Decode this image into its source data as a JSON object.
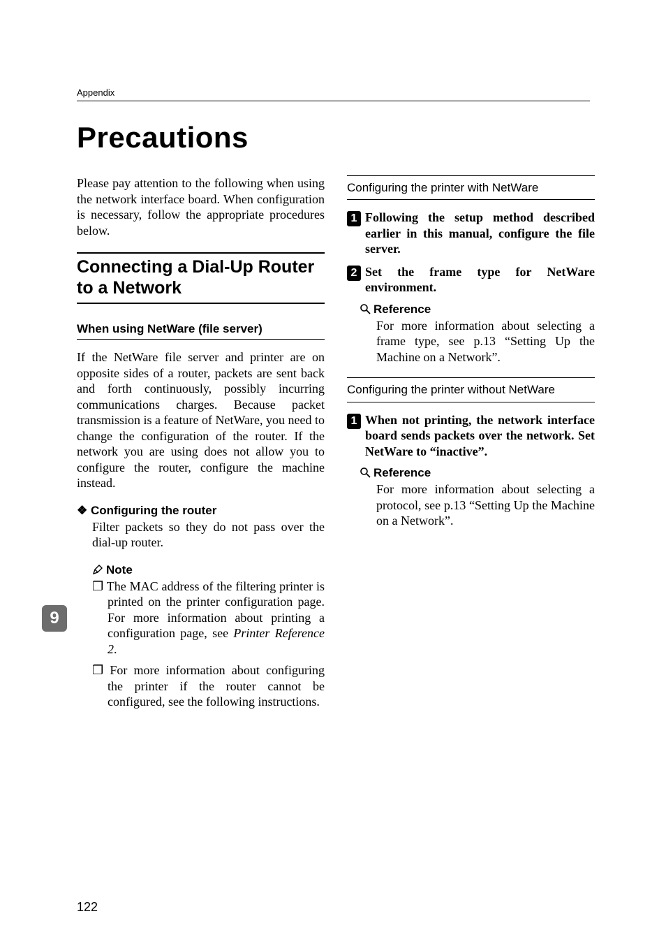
{
  "running_head": "Appendix",
  "title": "Precautions",
  "tab_number": "9",
  "page_number": "122",
  "left": {
    "intro": "Please pay attention to the following when using the network interface board. When configuration is necessary, follow the appropriate procedures below.",
    "h2": "Connecting a Dial-Up Router to a Network",
    "h3": "When using NetWare (file server)",
    "body1": "If the NetWare file server and printer are on opposite sides of a router, packets are sent back and forth continuously, possibly incurring communications charges. Because packet transmission is a feature of NetWare, you need to change the configuration of the router. If the network you are using does not allow you to configure the router, configure the machine instead.",
    "diamond_label": "❖ Configuring the router",
    "diamond_body": "Filter packets so they do not pass over the dial-up router.",
    "note_label": "Note",
    "note_items": [
      "The MAC address of the filtering printer is printed on the printer configuration page. For more information about printing a configuration page, see ",
      "For more information about configuring the printer if the router cannot be configured, see the following instructions."
    ],
    "note_item1_italic": "Printer Reference 2",
    "note_item1_tail": "."
  },
  "right": {
    "h4a": "Configuring the printer with NetWare",
    "step1": "Following the setup method described earlier in this manual, configure the file server.",
    "step2": "Set the frame type for NetWare environment.",
    "ref_label": "Reference",
    "ref1": "For more information about selecting a frame type, see p.13 “Setting Up the Machine on a Network”.",
    "h4b": "Configuring the printer without NetWare",
    "stepb1": "When not printing, the network interface board sends packets over the network. Set NetWare to “inactive”.",
    "ref2": "For more information about selecting a protocol, see p.13 “Setting Up the Machine on a Network”."
  }
}
